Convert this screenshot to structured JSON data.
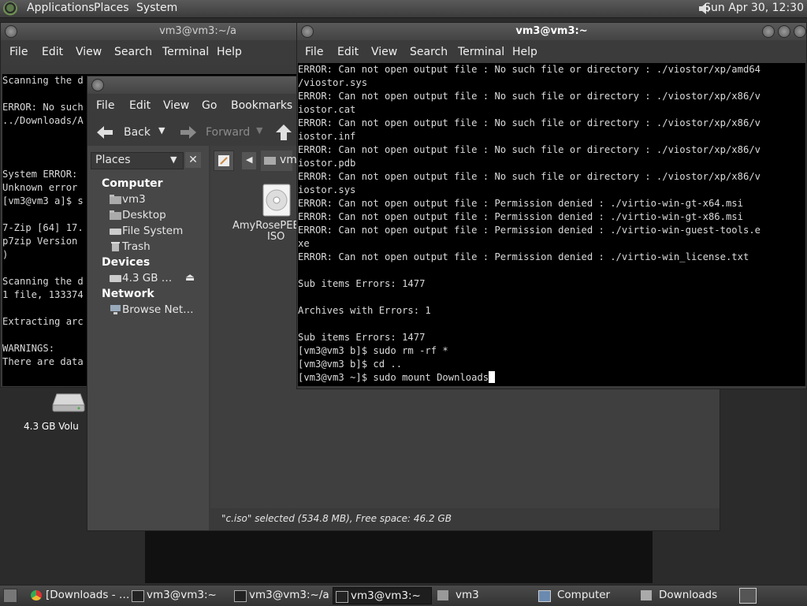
{
  "top_panel": {
    "menus": [
      "Applications",
      "Places",
      "System"
    ],
    "clock": "Sun Apr 30, 12:30"
  },
  "desktop": {
    "drive_label": "4.3 GB Volu"
  },
  "back_terminal": {
    "title": "vm3@vm3:~/a",
    "menu": [
      "File",
      "Edit",
      "View",
      "Search",
      "Terminal",
      "Help"
    ],
    "lines": [
      "Scanning the d",
      "",
      "ERROR: No such",
      "../Downloads/A",
      "",
      "",
      "",
      "System ERROR:",
      "Unknown error",
      "[vm3@vm3 a]$ s",
      "",
      "7-Zip [64] 17.",
      "p7zip Version",
      ")",
      "",
      "Scanning the d",
      "1 file, 133374",
      "",
      "Extracting arc",
      "",
      "WARNINGS:",
      "There are data"
    ]
  },
  "file_manager": {
    "menu": [
      "File",
      "Edit",
      "View",
      "Go",
      "Bookmarks"
    ],
    "back_label": "Back",
    "forward_label": "Forward",
    "path_button": "vm",
    "places_label": "Places",
    "sections": {
      "computer": "Computer",
      "devices": "Devices",
      "network": "Network"
    },
    "computer_items": [
      "vm3",
      "Desktop",
      "File System",
      "Trash"
    ],
    "device_items": [
      "4.3 GB …"
    ],
    "network_items": [
      "Browse Net…"
    ],
    "file": {
      "name_line1": "AmyRosePEB",
      "name_line2": "ISO"
    },
    "status": "\"c.iso\" selected (534.8 MB), Free space: 46.2 GB"
  },
  "front_terminal": {
    "title": "vm3@vm3:~",
    "menu": [
      "File",
      "Edit",
      "View",
      "Search",
      "Terminal",
      "Help"
    ],
    "lines": [
      "ERROR: Can not open output file : No such file or directory : ./viostor/xp/amd64",
      "/viostor.sys",
      "ERROR: Can not open output file : No such file or directory : ./viostor/xp/x86/v",
      "iostor.cat",
      "ERROR: Can not open output file : No such file or directory : ./viostor/xp/x86/v",
      "iostor.inf",
      "ERROR: Can not open output file : No such file or directory : ./viostor/xp/x86/v",
      "iostor.pdb",
      "ERROR: Can not open output file : No such file or directory : ./viostor/xp/x86/v",
      "iostor.sys",
      "ERROR: Can not open output file : Permission denied : ./virtio-win-gt-x64.msi",
      "ERROR: Can not open output file : Permission denied : ./virtio-win-gt-x86.msi",
      "ERROR: Can not open output file : Permission denied : ./virtio-win-guest-tools.e",
      "xe",
      "ERROR: Can not open output file : Permission denied : ./virtio-win_license.txt",
      "",
      "Sub items Errors: 1477",
      "",
      "Archives with Errors: 1",
      "",
      "Sub items Errors: 1477",
      "[vm3@vm3 b]$ sudo rm -rf *",
      "[vm3@vm3 b]$ cd ..",
      "[vm3@vm3 ~]$ sudo mount Downloads"
    ]
  },
  "taskbar": {
    "items": [
      {
        "label": "[Downloads - …",
        "icon": "chrome-icon"
      },
      {
        "label": "vm3@vm3:~",
        "icon": "terminal-icon"
      },
      {
        "label": "vm3@vm3:~/a",
        "icon": "terminal-icon"
      },
      {
        "label": "vm3@vm3:~",
        "icon": "terminal-icon"
      },
      {
        "label": "vm3",
        "icon": "home-folder-icon"
      },
      {
        "label": "Computer",
        "icon": "computer-icon"
      },
      {
        "label": "Downloads",
        "icon": "folder-icon"
      }
    ]
  }
}
